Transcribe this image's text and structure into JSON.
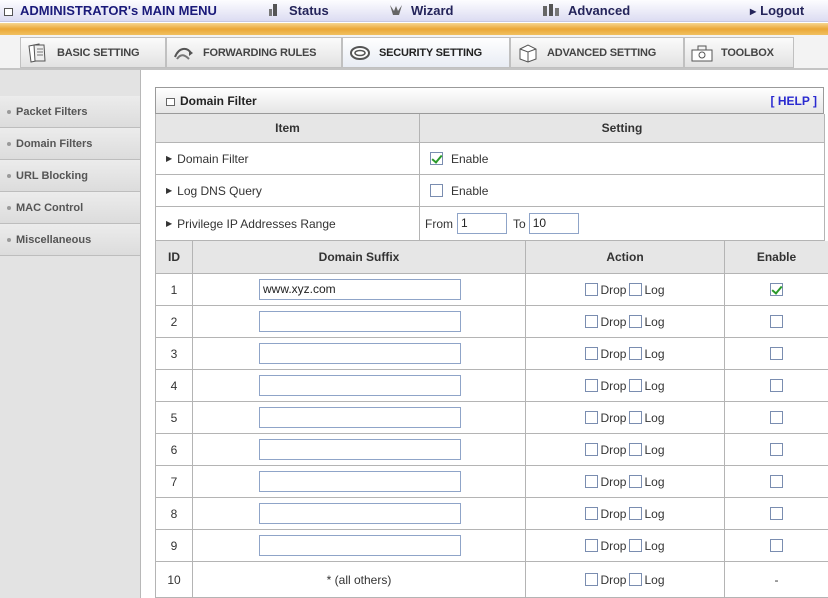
{
  "topnav": {
    "title": "ADMINISTRATOR's MAIN MENU",
    "status": "Status",
    "wizard": "Wizard",
    "advanced": "Advanced",
    "logout": "Logout"
  },
  "tabs": [
    {
      "label": "BASIC SETTING",
      "icon": "document-icon"
    },
    {
      "label": "FORWARDING RULES",
      "icon": "arrows-icon"
    },
    {
      "label": "SECURITY SETTING",
      "icon": "lock-icon"
    },
    {
      "label": "ADVANCED SETTING",
      "icon": "box-icon"
    },
    {
      "label": "TOOLBOX",
      "icon": "toolbox-icon"
    }
  ],
  "active_tab": "SECURITY SETTING",
  "sidebar": {
    "items": [
      {
        "label": "Packet Filters"
      },
      {
        "label": "Domain Filters"
      },
      {
        "label": "URL Blocking"
      },
      {
        "label": "MAC Control"
      },
      {
        "label": "Miscellaneous"
      }
    ]
  },
  "panel": {
    "title": "Domain Filter",
    "help": "[ HELP ]"
  },
  "settings": {
    "item_header": "Item",
    "setting_header": "Setting",
    "rows": [
      {
        "label": "Domain Filter",
        "checkbox_label": "Enable",
        "checked": true
      },
      {
        "label": "Log DNS Query",
        "checkbox_label": "Enable",
        "checked": false
      }
    ],
    "range": {
      "label": "Privilege IP Addresses Range",
      "from_label": "From",
      "from_value": "1",
      "to_label": "To",
      "to_value": "10"
    }
  },
  "filter_table": {
    "headers": {
      "id": "ID",
      "suffix": "Domain Suffix",
      "action": "Action",
      "enable": "Enable"
    },
    "drop_label": "Drop",
    "log_label": "Log",
    "rows": [
      {
        "id": "1",
        "suffix": "www.xyz.com",
        "enabled": true
      },
      {
        "id": "2",
        "suffix": "",
        "enabled": false
      },
      {
        "id": "3",
        "suffix": "",
        "enabled": false
      },
      {
        "id": "4",
        "suffix": "",
        "enabled": false
      },
      {
        "id": "5",
        "suffix": "",
        "enabled": false
      },
      {
        "id": "6",
        "suffix": "",
        "enabled": false
      },
      {
        "id": "7",
        "suffix": "",
        "enabled": false
      },
      {
        "id": "8",
        "suffix": "",
        "enabled": false
      },
      {
        "id": "9",
        "suffix": "",
        "enabled": false
      }
    ],
    "last_row": {
      "id": "10",
      "suffix_text": "* (all others)",
      "enable_text": "-"
    }
  },
  "colors": {
    "accent_orange": "#eba737",
    "nav_text": "#24245a",
    "help_link": "#2a2ad0",
    "check_green": "#2a9a2a"
  }
}
